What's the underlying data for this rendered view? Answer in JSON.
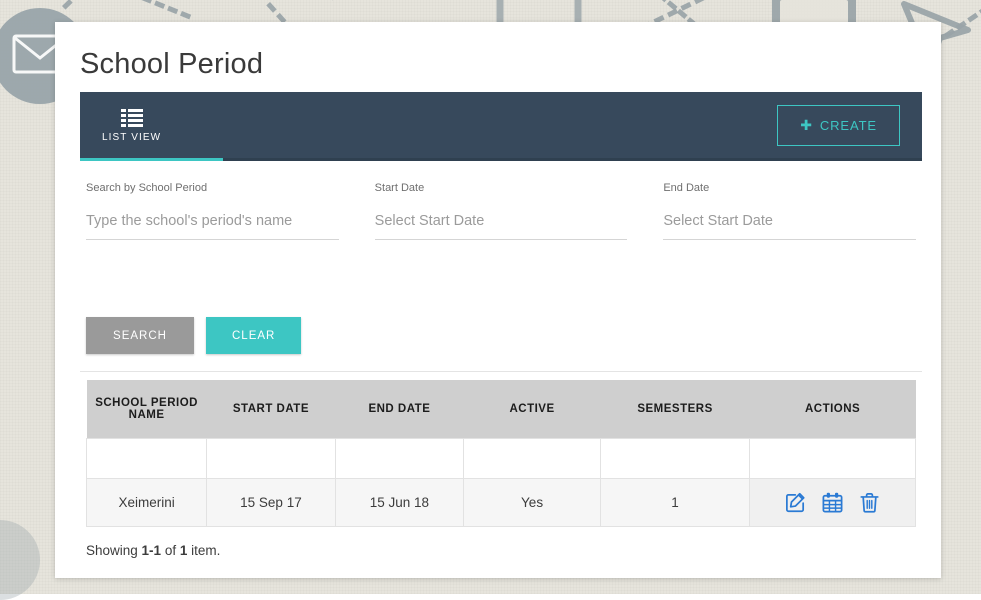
{
  "page": {
    "title": "School Period"
  },
  "toolbar": {
    "tab_label": "LIST VIEW",
    "tab_icon": "list-view-icon",
    "create_label": "CREATE",
    "create_icon": "plus-icon",
    "bar_color": "#37495c",
    "accent_color": "#3dc6c3"
  },
  "filters": {
    "school_period": {
      "label": "Search by School Period",
      "placeholder": "Type the school's period's name",
      "value": ""
    },
    "start_date": {
      "label": "Start Date",
      "placeholder": "Select Start Date",
      "value": ""
    },
    "end_date": {
      "label": "End Date",
      "placeholder": "Select Start Date",
      "value": ""
    }
  },
  "buttons": {
    "search_label": "SEARCH",
    "search_color": "#9a9a9a",
    "clear_label": "CLEAR",
    "clear_color": "#3dc6c3"
  },
  "table": {
    "columns": [
      "SCHOOL PERIOD NAME",
      "START DATE",
      "END DATE",
      "ACTIVE",
      "SEMESTERS",
      "ACTIONS"
    ],
    "filter_row": [
      "",
      "",
      "",
      "",
      "",
      ""
    ],
    "rows": [
      {
        "name": "Xeimerini",
        "start_date": "15 Sep 17",
        "end_date": "15 Jun 18",
        "active": "Yes",
        "semesters": "1",
        "actions": [
          "edit-icon",
          "calendar-icon",
          "trash-icon"
        ]
      }
    ],
    "action_icon_color": "#2a7ad4"
  },
  "footer": {
    "showing_prefix": "Showing ",
    "range": "1-1",
    "of": " of ",
    "count": "1",
    "suffix": " item."
  }
}
